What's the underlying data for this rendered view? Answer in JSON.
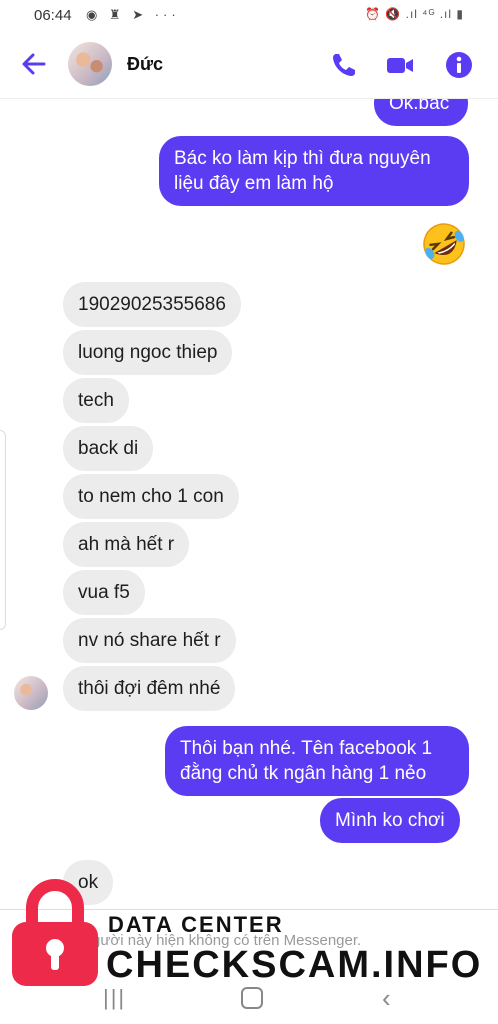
{
  "status_bar": {
    "time": "06:44",
    "left_icons": "◉ ♜ ➤ ···",
    "right_icons": "⏰ 🔇 .ıl ⁴ᴳ .ıl ▮"
  },
  "header": {
    "contact_name": "Đức"
  },
  "messages": [
    {
      "dir": "out",
      "text": "Ok.bac"
    },
    {
      "dir": "out",
      "text": "Bác ko làm kịp thì đưa nguyên liệu đây em làm hộ"
    },
    {
      "dir": "out",
      "emoji": "rolling-on-floor-laughing"
    },
    {
      "dir": "in",
      "text": "19029025355686"
    },
    {
      "dir": "in",
      "text": "luong ngoc thiep"
    },
    {
      "dir": "in",
      "text": "tech"
    },
    {
      "dir": "in",
      "text": "back di"
    },
    {
      "dir": "in",
      "text": "to nem cho 1 con"
    },
    {
      "dir": "in",
      "text": "ah mà hết r"
    },
    {
      "dir": "in",
      "text": "vua f5"
    },
    {
      "dir": "in",
      "text": "nv nó share hết r"
    },
    {
      "dir": "in",
      "text": "thôi đợi đêm nhé"
    },
    {
      "dir": "out",
      "text": "Thôi bạn nhé. Tên facebook 1 đằng chủ tk ngân hàng 1 nẻo"
    },
    {
      "dir": "out",
      "text": "Mình ko chơi"
    },
    {
      "dir": "in",
      "text": "ok"
    }
  ],
  "footer": {
    "note": "gười này hiện không có trên Messenger."
  },
  "navbar": {
    "recents": "|||",
    "back": "‹"
  },
  "watermark": {
    "line1": "DATA CENTER",
    "line2": "CHECKSCAM.INFO"
  },
  "colors": {
    "accent": "#5b3cf2",
    "incoming_bubble": "#ececec",
    "watermark_red": "#ee2a4a"
  }
}
